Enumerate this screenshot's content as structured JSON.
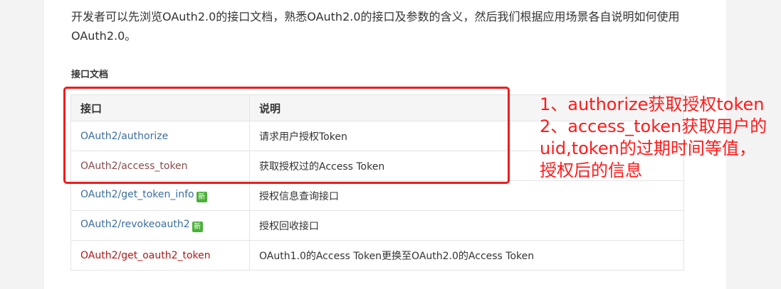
{
  "intro": {
    "text": "开发者可以先浏览OAuth2.0的接口文档，熟悉OAuth2.0的接口及参数的含义，然后我们根据应用场景各自说明如何使用OAuth2.0。"
  },
  "section_title": "接口文档",
  "table": {
    "headers": [
      "接口",
      "说明"
    ],
    "rows": [
      {
        "endpoint": "OAuth2/authorize",
        "desc": "请求用户授权Token",
        "color": "#3c6e9f",
        "badge": ""
      },
      {
        "endpoint": "OAuth2/access_token",
        "desc": "获取授权过的Access Token",
        "color": "#8a4b4b",
        "badge": ""
      },
      {
        "endpoint": "OAuth2/get_token_info",
        "desc": "授权信息查询接口",
        "color": "#3c6e9f",
        "badge": "新"
      },
      {
        "endpoint": "OAuth2/revokeoauth2",
        "desc": "授权回收接口",
        "color": "#3c6e9f",
        "badge": "新"
      },
      {
        "endpoint": "OAuth2/get_oauth2_token",
        "desc": "OAuth1.0的Access Token更换至OAuth2.0的Access Token",
        "color": "#b01818",
        "badge": ""
      }
    ]
  },
  "annotation": {
    "lines": [
      "1、authorize获取授权token",
      "2、access_token获取用户的",
      "uid,token的过期时间等值，",
      "授权后的信息"
    ],
    "color": "#ff1a1a"
  }
}
